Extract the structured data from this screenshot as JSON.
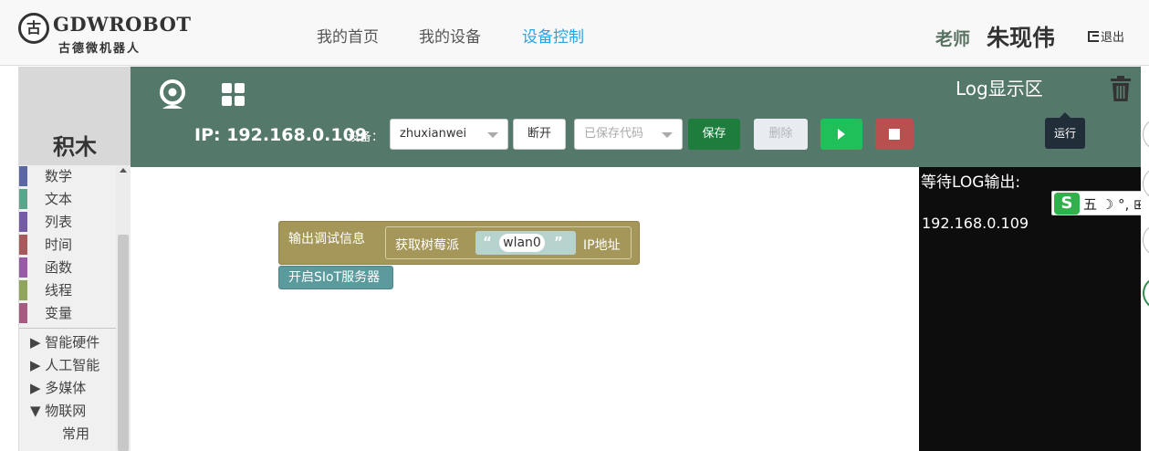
{
  "header": {
    "logo_text": "GDWROBOT",
    "logo_sub": "古德微机器人",
    "logo_mark": "古",
    "nav": [
      "我的首页",
      "我的设备",
      "设备控制"
    ],
    "active_nav": "设备控制",
    "user_role": "老师",
    "user_name": "朱现伟",
    "logout_label": "退出"
  },
  "sidebar": {
    "title": "积木",
    "categories": [
      {
        "label": "数学",
        "color": "#5b67a5"
      },
      {
        "label": "文本",
        "color": "#5ba58c"
      },
      {
        "label": "列表",
        "color": "#745ba5"
      },
      {
        "label": "时间",
        "color": "#a55b5b"
      },
      {
        "label": "函数",
        "color": "#995ba5"
      },
      {
        "label": "线程",
        "color": "#8ea55b"
      },
      {
        "label": "变量",
        "color": "#a55b80"
      }
    ],
    "groups": [
      "▶ 智能硬件",
      "▶ 人工智能",
      "▶ 多媒体",
      "▼ 物联网"
    ],
    "sub_items": [
      "常用"
    ]
  },
  "toolbar": {
    "ip_label": "IP: 192.168.0.109",
    "device_label": "设备：",
    "device_value": "zhuxianwei",
    "disconnect_label": "断开",
    "saved_code_placeholder": "已保存代码",
    "save_label": "保存",
    "delete_label": "删除"
  },
  "log": {
    "title": "Log显示区",
    "tooltip": "运行",
    "header_line": "等待LOG输出:",
    "lines": [
      "192.168.0.109"
    ]
  },
  "ime": {
    "logo": "S",
    "text": "五 ☽ °, ⊞"
  },
  "workspace": {
    "print_block": "输出调试信息",
    "get_block_prefix": "获取树莓派",
    "string_value": "wlan0",
    "get_block_suffix": "IP地址",
    "siot_block": "开启SIoT服务器",
    "quote_open": "“",
    "quote_close": "”"
  },
  "colors": {
    "toolbar_bg": "#54786a",
    "save_green": "#1e7d3c",
    "run_green": "#1fbf5a",
    "stop_red": "#b85050",
    "active_nav": "#2aa3e0"
  }
}
